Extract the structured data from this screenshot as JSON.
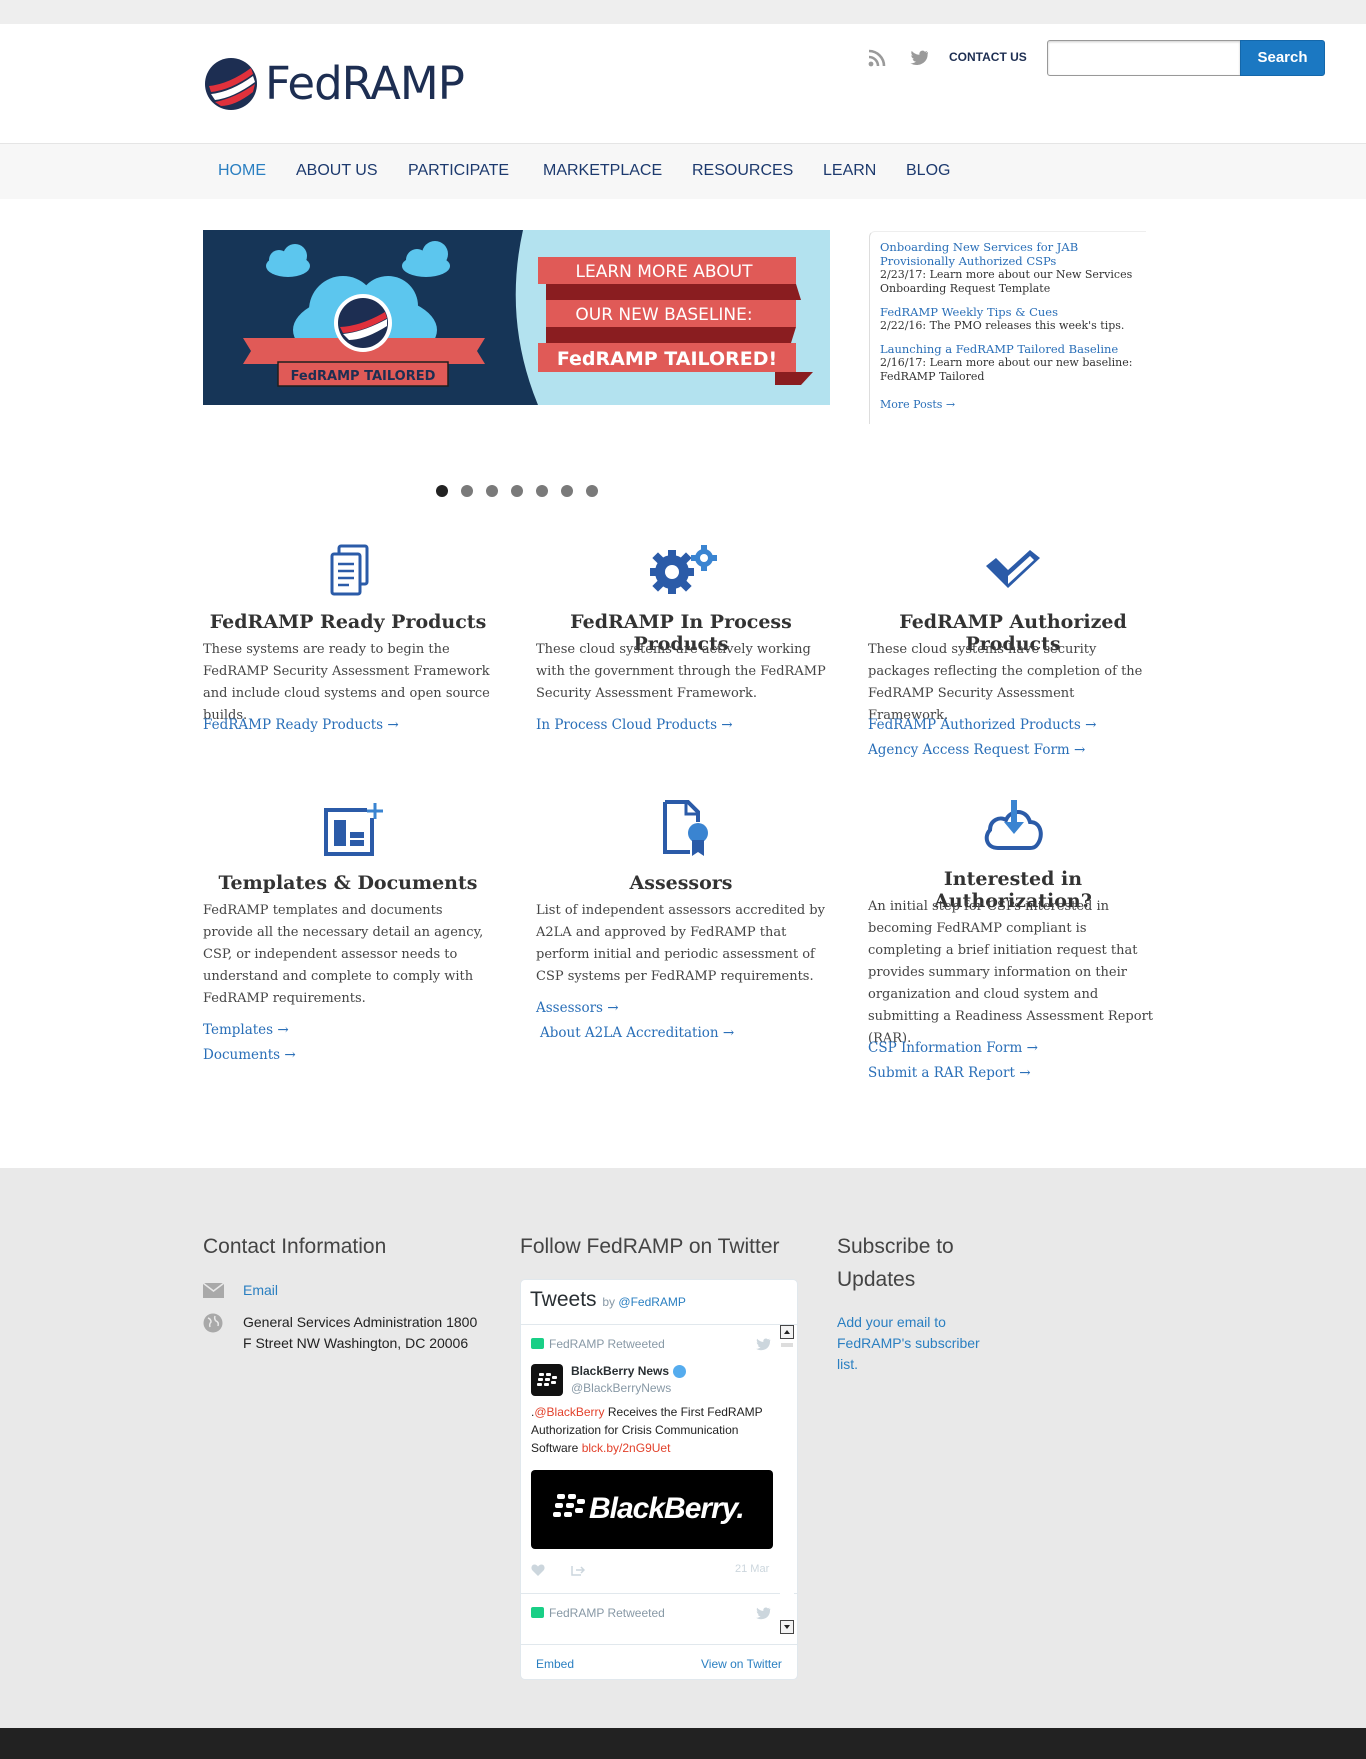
{
  "header": {
    "logo_text": "FedRAMP",
    "contact_label": "CONTACT US",
    "search_placeholder": "",
    "search_button": "Search"
  },
  "nav": {
    "items": [
      {
        "label": "HOME",
        "active": true
      },
      {
        "label": "ABOUT US"
      },
      {
        "label": "PARTICIPATE"
      },
      {
        "label": "MARKETPLACE"
      },
      {
        "label": "RESOURCES"
      },
      {
        "label": "LEARN"
      },
      {
        "label": "BLOG"
      }
    ]
  },
  "banner": {
    "line1": "LEARN MORE ABOUT",
    "line2": "OUR NEW BASELINE:",
    "line3": "FedRAMP TAILORED!",
    "badge": "FedRAMP TAILORED"
  },
  "news": {
    "items": [
      {
        "title": "Onboarding New Services for JAB Provisionally Authorized CSPs",
        "desc": "2/23/17: Learn more about our New Services Onboarding Request Template"
      },
      {
        "title": "FedRAMP Weekly Tips & Cues",
        "desc": "2/22/16: The PMO releases this week's tips."
      },
      {
        "title": "Launching a FedRAMP Tailored Baseline",
        "desc": "2/16/17: Learn more about our new baseline: FedRAMP Tailored"
      }
    ],
    "more": "More Posts →"
  },
  "slider": {
    "count": 7,
    "active": 0
  },
  "features": [
    {
      "title": "FedRAMP Ready Products",
      "text": "These systems are ready to begin the FedRAMP Security Assessment Framework and include cloud systems and open source builds.",
      "links": [
        "FedRAMP Ready Products →"
      ]
    },
    {
      "title": "FedRAMP In Process Products",
      "text": "These cloud systems are actively working with the government through the FedRAMP Security Assessment Framework.",
      "links": [
        "In Process Cloud Products →"
      ]
    },
    {
      "title": "FedRAMP Authorized  Products",
      "text": "These cloud systems have security packages reflecting the completion of the FedRAMP Security Assessment Framework.",
      "links": [
        "FedRAMP Authorized Products →",
        "Agency Access Request Form →"
      ]
    },
    {
      "title": "Templates & Documents",
      "text": "FedRAMP templates and documents provide all the necessary detail an agency, CSP, or independent assessor needs to understand and complete to comply with FedRAMP requirements.",
      "links": [
        "Templates →",
        "Documents →"
      ]
    },
    {
      "title": "Assessors",
      "text": "List of independent assessors accredited by A2LA and approved by FedRAMP that perform initial and periodic assessment of CSP systems per FedRAMP requirements.",
      "links": [
        "Assessors →",
        "About A2LA Accreditation →"
      ]
    },
    {
      "title": "Interested in Authorization?",
      "text": "An initial step for CSPs interested in becoming FedRAMP compliant is completing a brief initiation request that provides summary information on their organization and cloud system and submitting a Readiness Assessment Report (RAR).",
      "links": [
        "CSP Information Form →",
        "Submit a RAR Report →"
      ]
    }
  ],
  "footer": {
    "contact_heading": "Contact Information",
    "email_label": "Email",
    "address": "General Services Administration 1800 F Street NW Washington, DC 20006",
    "twitter_heading": "Follow FedRAMP on Twitter",
    "subscribe_heading": "Subscribe to Updates",
    "subscribe_link": "Add your email to FedRAMP's subscriber list."
  },
  "twitter": {
    "title": "Tweets",
    "by": "by",
    "handle": "@FedRAMP",
    "retweeted": "FedRAMP Retweeted",
    "account_name": "BlackBerry News",
    "account_handle": "@BlackBerryNews",
    "tweet_pre": ".",
    "tweet_mention": "@BlackBerry",
    "tweet_mid": " Receives the First FedRAMP Authorization for Crisis Communication Software ",
    "tweet_link": "blck.by/2nG9Uet",
    "card_text": "BlackBerry.",
    "date": "21 Mar",
    "retweeted2": "FedRAMP Retweeted",
    "embed": "Embed",
    "view": "View on Twitter"
  },
  "colors": {
    "brand_navy": "#1d2e52",
    "link_blue": "#2a6fb8",
    "search_blue": "#1b78c2",
    "icon_blue": "#2b5ba8"
  }
}
